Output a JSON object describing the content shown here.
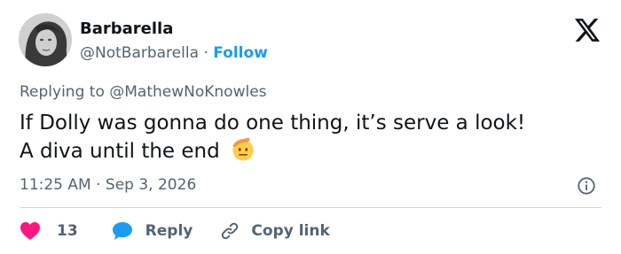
{
  "tweet": {
    "author_name": "Barbarella",
    "author_handle": "@NotBarbarella",
    "separator": "·",
    "follow_label": "Follow",
    "replying_prefix": "Replying to",
    "replying_to": "@MathewNoKnowles",
    "text_line1": "If Dolly was gonna do one thing, it’s serve a look!",
    "text_line2": "A diva until the end",
    "emoji": "saluting-face-emoji",
    "time": "11:25 AM",
    "date": "Sep 3, 2026"
  },
  "actions": {
    "like_count": "13",
    "reply_label": "Reply",
    "copy_link_label": "Copy link"
  },
  "icons": {
    "logo": "x-logo-icon",
    "info": "info-icon",
    "like": "heart-icon",
    "reply": "speech-bubble-icon",
    "copy": "link-icon"
  },
  "colors": {
    "text": "#0f1419",
    "secondary": "#536471",
    "accent": "#1d9bf0",
    "like": "#f91880",
    "divider": "#cfd9de"
  }
}
